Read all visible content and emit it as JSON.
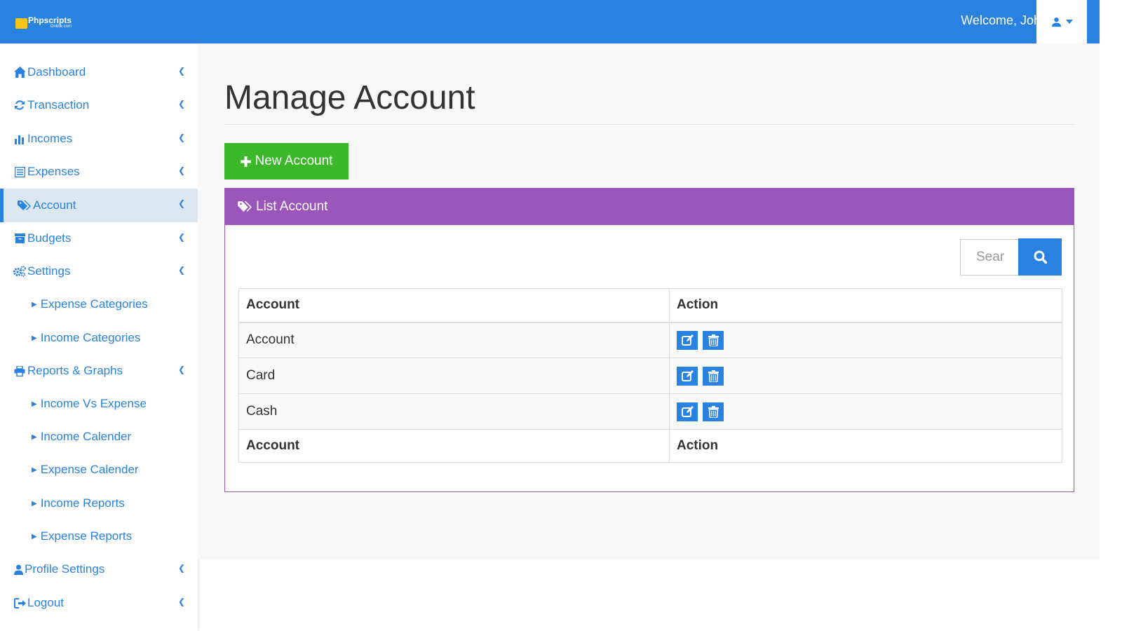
{
  "brand": {
    "name": "Phpscripts",
    "sub": "Online.com"
  },
  "header": {
    "welcome": "Welcome, John"
  },
  "sidebar": {
    "items": [
      {
        "label": "Dashboard",
        "icon": "home-icon"
      },
      {
        "label": "Transaction",
        "icon": "refresh-icon"
      },
      {
        "label": "Incomes",
        "icon": "bar-chart-icon"
      },
      {
        "label": "Expenses",
        "icon": "list-alt-icon"
      },
      {
        "label": "Account",
        "icon": "tags-icon",
        "active": true
      },
      {
        "label": "Budgets",
        "icon": "archive-icon"
      },
      {
        "label": "Settings",
        "icon": "cogs-icon"
      },
      {
        "label": "Expense Categories",
        "sub": true
      },
      {
        "label": "Income Categories",
        "sub": true
      },
      {
        "label": "Reports & Graphs",
        "icon": "print-icon"
      },
      {
        "label": "Income Vs Expense",
        "sub": true
      },
      {
        "label": "Income Calender",
        "sub": true
      },
      {
        "label": "Expense Calender",
        "sub": true
      },
      {
        "label": "Income Reports",
        "sub": true
      },
      {
        "label": "Expense Reports",
        "sub": true
      },
      {
        "label": "Profile Settings",
        "icon": "user-icon"
      },
      {
        "label": "Logout",
        "icon": "sign-out-icon"
      }
    ]
  },
  "main": {
    "title": "Manage Account",
    "new_button": "New Account",
    "panel_title": "List Account",
    "search": {
      "value": "Sear"
    },
    "table": {
      "headers": [
        "Account",
        "Action"
      ],
      "rows": [
        [
          "Account"
        ],
        [
          "Card"
        ],
        [
          "Cash"
        ]
      ],
      "footers": [
        "Account",
        "Action"
      ]
    }
  },
  "colors": {
    "primary": "#2a82e0",
    "success": "#3ab82a",
    "panel": "#9b56bb",
    "brand_logo": "#f5c518"
  }
}
